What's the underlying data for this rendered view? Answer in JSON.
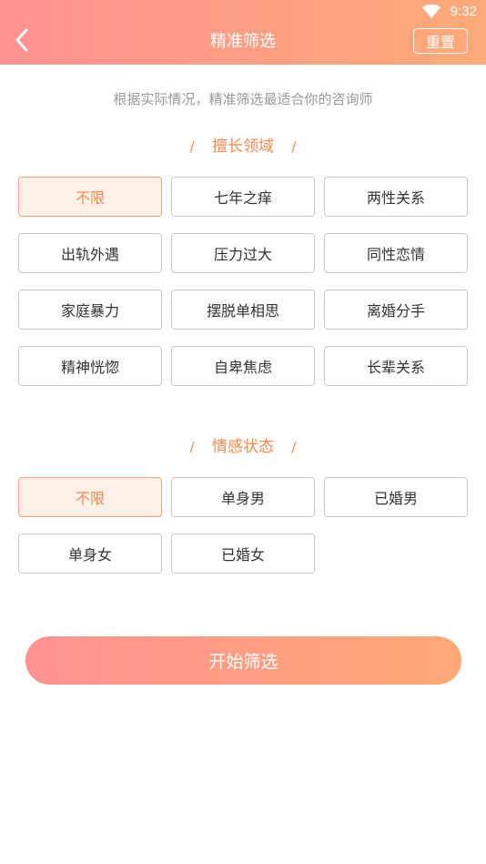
{
  "status_bar": {
    "time": "9:32",
    "wifi_icon": "wifi-icon"
  },
  "header": {
    "back_icon": "chevron-left-icon",
    "title": "精准筛选",
    "reset_label": "重置"
  },
  "subtitle": "根据实际情况，精准筛选最适合你的咨询师",
  "sections": {
    "expertise": {
      "title": "擅长领域",
      "slash": "/",
      "options": [
        "不限",
        "七年之痒",
        "两性关系",
        "出轨外遇",
        "压力过大",
        "同性恋情",
        "家庭暴力",
        "摆脱单相思",
        "离婚分手",
        "精神恍惚",
        "自卑焦虑",
        "长辈关系"
      ],
      "selected": "不限"
    },
    "status": {
      "title": "情感状态",
      "slash": "/",
      "options": [
        "不限",
        "单身男",
        "已婚男",
        "单身女",
        "已婚女"
      ],
      "selected": "不限"
    }
  },
  "start_button_label": "开始筛选",
  "colors": {
    "accent": "#f5894f",
    "header_start": "#ff9292",
    "header_end": "#ffaa78"
  }
}
